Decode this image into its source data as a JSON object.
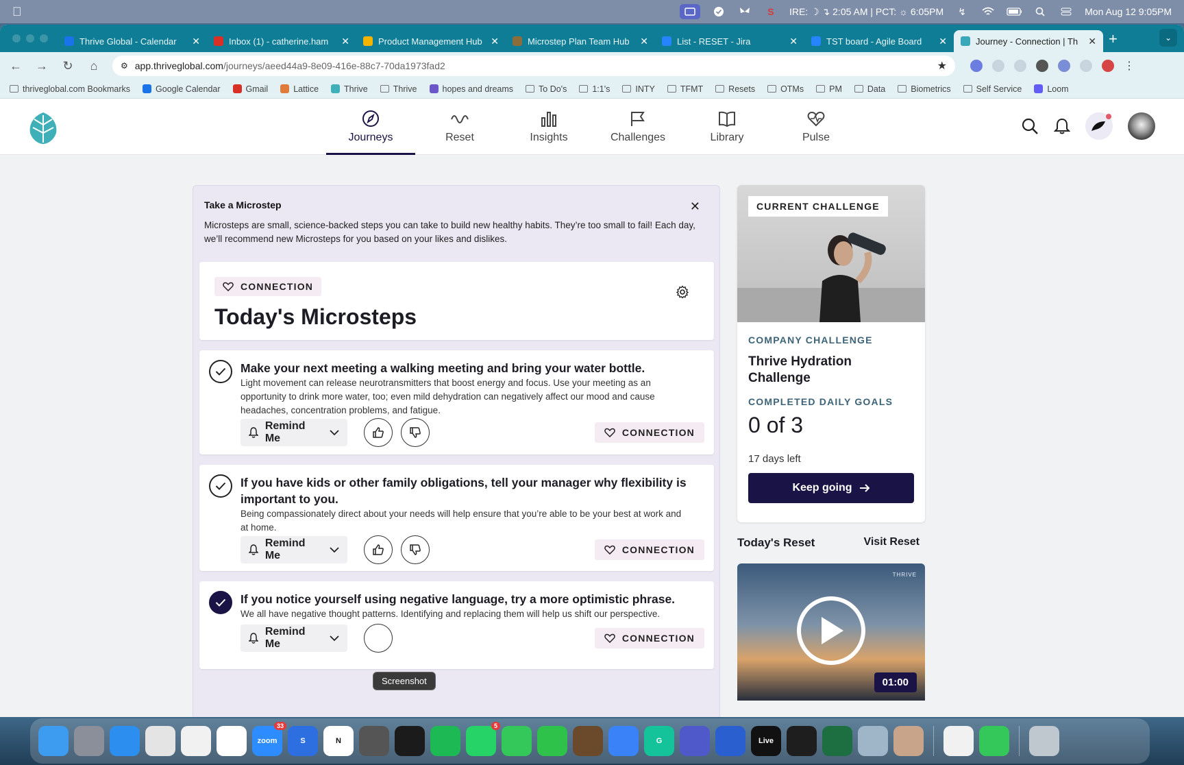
{
  "menubar": {
    "status": "IRE: ☽ ↴ 2:05 AM | PCT: ☼ 6:05PM",
    "datetime": "Mon Aug 12  9:05PM"
  },
  "browser": {
    "tabs": [
      {
        "title": "Thrive Global - Calendar",
        "color": "#1a73e8"
      },
      {
        "title": "Inbox (1) - catherine.ham",
        "color": "#d93025"
      },
      {
        "title": "Product Management Hub",
        "color": "#f4b400"
      },
      {
        "title": "Microstep Plan Team Hub",
        "color": "#8a6d3b"
      },
      {
        "title": "List - RESET - Jira",
        "color": "#2684ff"
      },
      {
        "title": "TST board - Agile Board",
        "color": "#2684ff"
      },
      {
        "title": "Journey - Connection | Th",
        "color": "#3aa8b8"
      }
    ],
    "url_host": "app.thriveglobal.com",
    "url_path": "/journeys/aeed44a9-8e09-416e-88c7-70da1973fad2",
    "bookmarks": [
      {
        "label": "thriveglobal.com Bookmarks",
        "kind": "folder"
      },
      {
        "label": "Google Calendar",
        "kind": "calendar"
      },
      {
        "label": "Gmail",
        "kind": "gmail"
      },
      {
        "label": "Lattice",
        "kind": "lattice"
      },
      {
        "label": "Thrive",
        "kind": "thrive"
      },
      {
        "label": "Thrive",
        "kind": "folder"
      },
      {
        "label": "hopes and dreams",
        "kind": "app"
      },
      {
        "label": "To Do's",
        "kind": "folder"
      },
      {
        "label": "1:1's",
        "kind": "folder"
      },
      {
        "label": "INTY",
        "kind": "folder"
      },
      {
        "label": "TFMT",
        "kind": "folder"
      },
      {
        "label": "Resets",
        "kind": "folder"
      },
      {
        "label": "OTMs",
        "kind": "folder"
      },
      {
        "label": "PM",
        "kind": "folder"
      },
      {
        "label": "Data",
        "kind": "folder"
      },
      {
        "label": "Biometrics",
        "kind": "folder"
      },
      {
        "label": "Self Service",
        "kind": "folder"
      },
      {
        "label": "Loom",
        "kind": "loom"
      }
    ]
  },
  "nav": {
    "items": [
      {
        "label": "Journeys",
        "icon": "compass-icon",
        "active": true
      },
      {
        "label": "Reset",
        "icon": "wave-icon",
        "active": false
      },
      {
        "label": "Insights",
        "icon": "bar-chart-icon",
        "active": false
      },
      {
        "label": "Challenges",
        "icon": "flag-icon",
        "active": false
      },
      {
        "label": "Library",
        "icon": "book-icon",
        "active": false
      },
      {
        "label": "Pulse",
        "icon": "heart-pulse-icon",
        "active": false
      }
    ]
  },
  "microsteps_card": {
    "title": "Take a Microstep",
    "description": "Microsteps are small, science-backed steps you can take to build new healthy habits. They’re too small to fail! Each day, we’ll recommend new Microsteps for you based on your likes and dislikes.",
    "tag": "CONNECTION",
    "heading": "Today's Microsteps",
    "items": [
      {
        "title": "Make your next meeting a walking meeting and bring your water bottle.",
        "body": "Light movement can release neurotransmitters that boost energy and focus. Use your meeting as an opportunity to drink more water, too; even mild dehydration can negatively affect our mood and cause headaches, concentration problems, and fatigue.",
        "remind_label": "Remind Me",
        "tag": "CONNECTION",
        "completed": false
      },
      {
        "title": "If you have kids or other family obligations, tell your manager why flexibility is important to you.",
        "body": "Being compassionately direct about your needs will help ensure that you’re able to be your best at work and at home.",
        "remind_label": "Remind Me",
        "tag": "CONNECTION",
        "completed": false
      },
      {
        "title": "If you notice yourself using negative language, try a more optimistic phrase.",
        "body": "We all have negative thought patterns. Identifying and replacing them will help us shift our perspective.",
        "remind_label": "Remind Me",
        "tag": "CONNECTION",
        "completed": true
      }
    ]
  },
  "tooltip": "Screenshot",
  "challenge": {
    "badge": "CURRENT CHALLENGE",
    "type_label": "COMPANY CHALLENGE",
    "name": "Thrive Hydration Challenge",
    "goals_label": "COMPLETED DAILY GOALS",
    "goals_value": "0 of 3",
    "days_left": "17 days left",
    "cta": "Keep going"
  },
  "reset": {
    "heading": "Today's Reset",
    "link": "Visit Reset",
    "duration": "01:00",
    "watermark": "THRIVE"
  },
  "dock": {
    "apps": [
      {
        "name": "finder-icon",
        "color": "#3d9bf0"
      },
      {
        "name": "settings-icon",
        "color": "#8a8f99"
      },
      {
        "name": "app-store-icon",
        "color": "#2c8ff0"
      },
      {
        "name": "launchpad-icon",
        "color": "#e4e4e4"
      },
      {
        "name": "chrome-icon",
        "color": "#f1f1f1"
      },
      {
        "name": "slack-icon",
        "color": "#ffffff"
      },
      {
        "name": "zoom-icon",
        "color": "#2d8cff",
        "label": "zoom",
        "badge": "33"
      },
      {
        "name": "s-app-icon",
        "color": "#2d6fe0",
        "label": "S"
      },
      {
        "name": "notion-icon",
        "color": "#ffffff",
        "label": "N"
      },
      {
        "name": "screenshot-icon",
        "color": "#555555"
      },
      {
        "name": "butterfly-icon",
        "color": "#1b1b1b"
      },
      {
        "name": "spotify-icon",
        "color": "#1db954"
      },
      {
        "name": "whatsapp-icon",
        "color": "#25d366",
        "badge": "5"
      },
      {
        "name": "messages-icon",
        "color": "#34c759"
      },
      {
        "name": "facetime-icon",
        "color": "#2fc24a"
      },
      {
        "name": "guitar-icon",
        "color": "#6a4a2a"
      },
      {
        "name": "freeform-icon",
        "color": "#3a82f7"
      },
      {
        "name": "grammarly-icon",
        "color": "#15c39a",
        "label": "G"
      },
      {
        "name": "teams-icon",
        "color": "#5059c9"
      },
      {
        "name": "compass-app-icon",
        "color": "#2a5fd0"
      },
      {
        "name": "ableton-live-icon",
        "color": "#111111",
        "label": "Live"
      },
      {
        "name": "figma-icon",
        "color": "#1e1e1e"
      },
      {
        "name": "excel-icon",
        "color": "#1d6f42"
      },
      {
        "name": "preview-icon",
        "color": "#9fb6c8"
      },
      {
        "name": "photo-icon",
        "color": "#c8a58a"
      },
      {
        "name": "chrome-small-icon",
        "color": "#f1f1f1"
      },
      {
        "name": "messages-small-icon",
        "color": "#34c759"
      },
      {
        "name": "trash-icon",
        "color": "#bfc7cf"
      }
    ]
  }
}
